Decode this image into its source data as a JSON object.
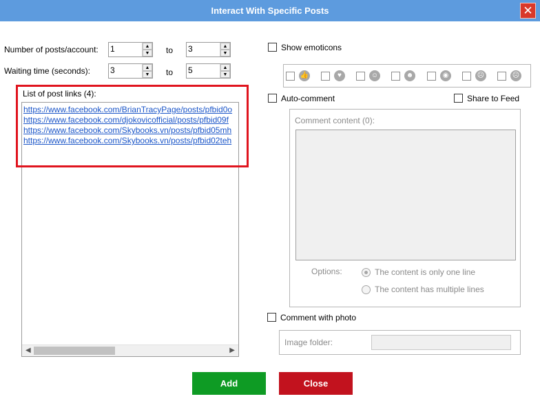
{
  "window": {
    "title": "Interact With Specific Posts",
    "close_glyph": "✕"
  },
  "left": {
    "posts_label": "Number of posts/account:",
    "posts_from": "1",
    "posts_to": "3",
    "to_label": "to",
    "wait_label": "Waiting time (seconds):",
    "wait_from": "3",
    "wait_to": "5",
    "links_label": "List of post links (4):",
    "links": [
      "https://www.facebook.com/BrianTracyPage/posts/pfbid0o",
      "https://www.facebook.com/djokovicofficial/posts/pfbid09f",
      "https://www.facebook.com/Skybooks.vn/posts/pfbid05mh",
      "https://www.facebook.com/Skybooks.vn/posts/pfbid02teh"
    ]
  },
  "right": {
    "show_emoticons": "Show emoticons",
    "emoticons": [
      "like-icon",
      "love-icon",
      "care-icon",
      "haha-icon",
      "wow-icon",
      "sad-icon",
      "angry-icon"
    ],
    "emoticon_glyphs": [
      "👍",
      "♥",
      "☺",
      "☻",
      "◉",
      "☹",
      "☹"
    ],
    "auto_comment": "Auto-comment",
    "share_to_feed": "Share to Feed",
    "comment_content_label": "Comment content (0):",
    "options_label": "Options:",
    "option_one_line": "The content is only one line",
    "option_multi_line": "The content has multiple lines",
    "comment_with_photo": "Comment with photo",
    "image_folder_label": "Image folder:"
  },
  "footer": {
    "add_label": "Add",
    "close_label": "Close",
    "colors": {
      "add": "#0e9b24",
      "close": "#c2121e",
      "title_bar": "#5d9bde",
      "highlight": "#e0141e"
    }
  }
}
